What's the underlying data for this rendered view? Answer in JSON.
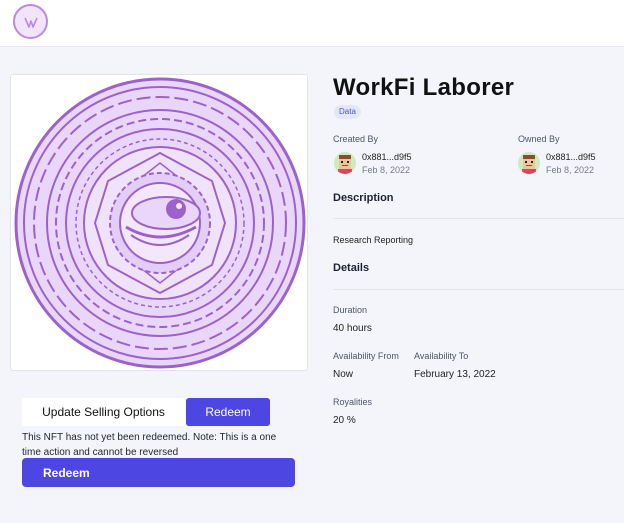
{
  "nft": {
    "title": "WorkFi Laborer",
    "badge": "Data",
    "created_by_label": "Created By",
    "owned_by_label": "Owned By",
    "creator": {
      "address": "0x881...d9f5",
      "date": "Feb 8, 2022"
    },
    "owner": {
      "address": "0x881...d9f5",
      "date": "Feb 8, 2022"
    }
  },
  "description": {
    "heading": "Description",
    "text": "Research Reporting"
  },
  "details": {
    "heading": "Details",
    "duration_label": "Duration",
    "duration_value": "40 hours",
    "availability_from_label": "Availability From",
    "availability_from_value": "Now",
    "availability_to_label": "Availability To",
    "availability_to_value": "February 13, 2022",
    "royalties_label": "Royalities",
    "royalties_value": "20 %"
  },
  "actions": {
    "update_selling_label": "Update Selling Options",
    "redeem_small_label": "Redeem",
    "note": "This NFT has not yet been redeemed. Note: This is a one time action and cannot be reversed",
    "redeem_big_label": "Redeem"
  },
  "colors": {
    "accent": "#4d46e2",
    "art_light": "#ead6fb",
    "art_dark": "#9b63c9"
  },
  "icons": {
    "logo": "workfi-logo-icon",
    "avatar": "pixel-avatar-icon"
  }
}
